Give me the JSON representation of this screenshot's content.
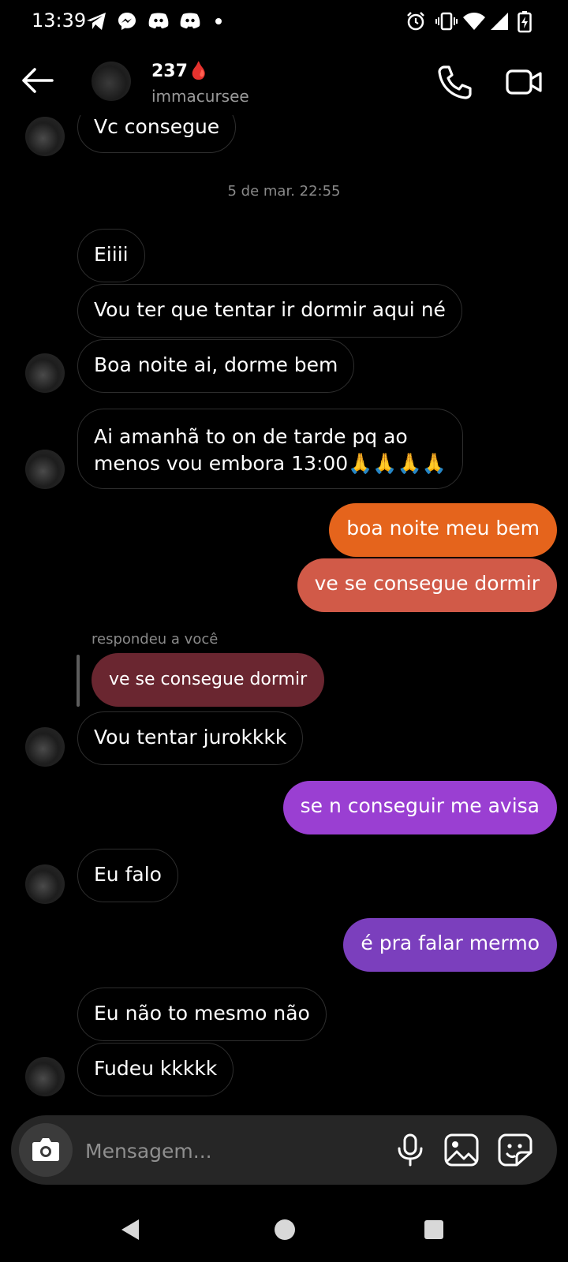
{
  "status_bar": {
    "time": "13:39",
    "left_icons": [
      "telegram-icon",
      "messenger-icon",
      "discord-icon",
      "discord-icon",
      "dot-icon"
    ],
    "right_icons": [
      "alarm-icon",
      "vibrate-icon",
      "wifi-icon",
      "signal-icon",
      "battery-charging-icon"
    ]
  },
  "header": {
    "contact_name": "237",
    "name_emoji": "🩸",
    "handle": "immacursee"
  },
  "messages": [
    {
      "dir": "in",
      "text": "Vc consegue"
    },
    {
      "timestamp": "5 de mar. 22:55"
    },
    {
      "dir": "in",
      "text": "Eiiii"
    },
    {
      "dir": "in",
      "text": "Vou ter que tentar ir dormir aqui né"
    },
    {
      "dir": "in",
      "text": "Boa noite ai, dorme bem"
    },
    {
      "dir": "in",
      "line1": "Ai amanhã to on de tarde pq ao",
      "line2": "menos vou embora 13:00🙏🙏🙏🙏"
    },
    {
      "dir": "out",
      "text": "boa noite meu bem",
      "color": "#e5641c"
    },
    {
      "dir": "out",
      "text": "ve se consegue dormir",
      "color": "#d15a48"
    },
    {
      "reply_label": "respondeu a você",
      "quoted": "ve se consegue dormir"
    },
    {
      "dir": "in",
      "text": "Vou tentar jurokkkk"
    },
    {
      "dir": "out",
      "text": "se n conseguir me avisa",
      "color": "#9a3fd2"
    },
    {
      "dir": "in",
      "text": "Eu falo"
    },
    {
      "dir": "out",
      "text": "é pra falar mermo",
      "color": "#7b3fbd"
    },
    {
      "dir": "in",
      "text": "Eu não to mesmo não"
    },
    {
      "dir": "in",
      "text": "Fudeu kkkkk"
    }
  ],
  "composer": {
    "placeholder": "Mensagem..."
  },
  "colors": {
    "background": "#000000",
    "incoming_border": "#2e2e2e",
    "reply_quote": "#6a2630",
    "composer_bg": "#262626"
  }
}
